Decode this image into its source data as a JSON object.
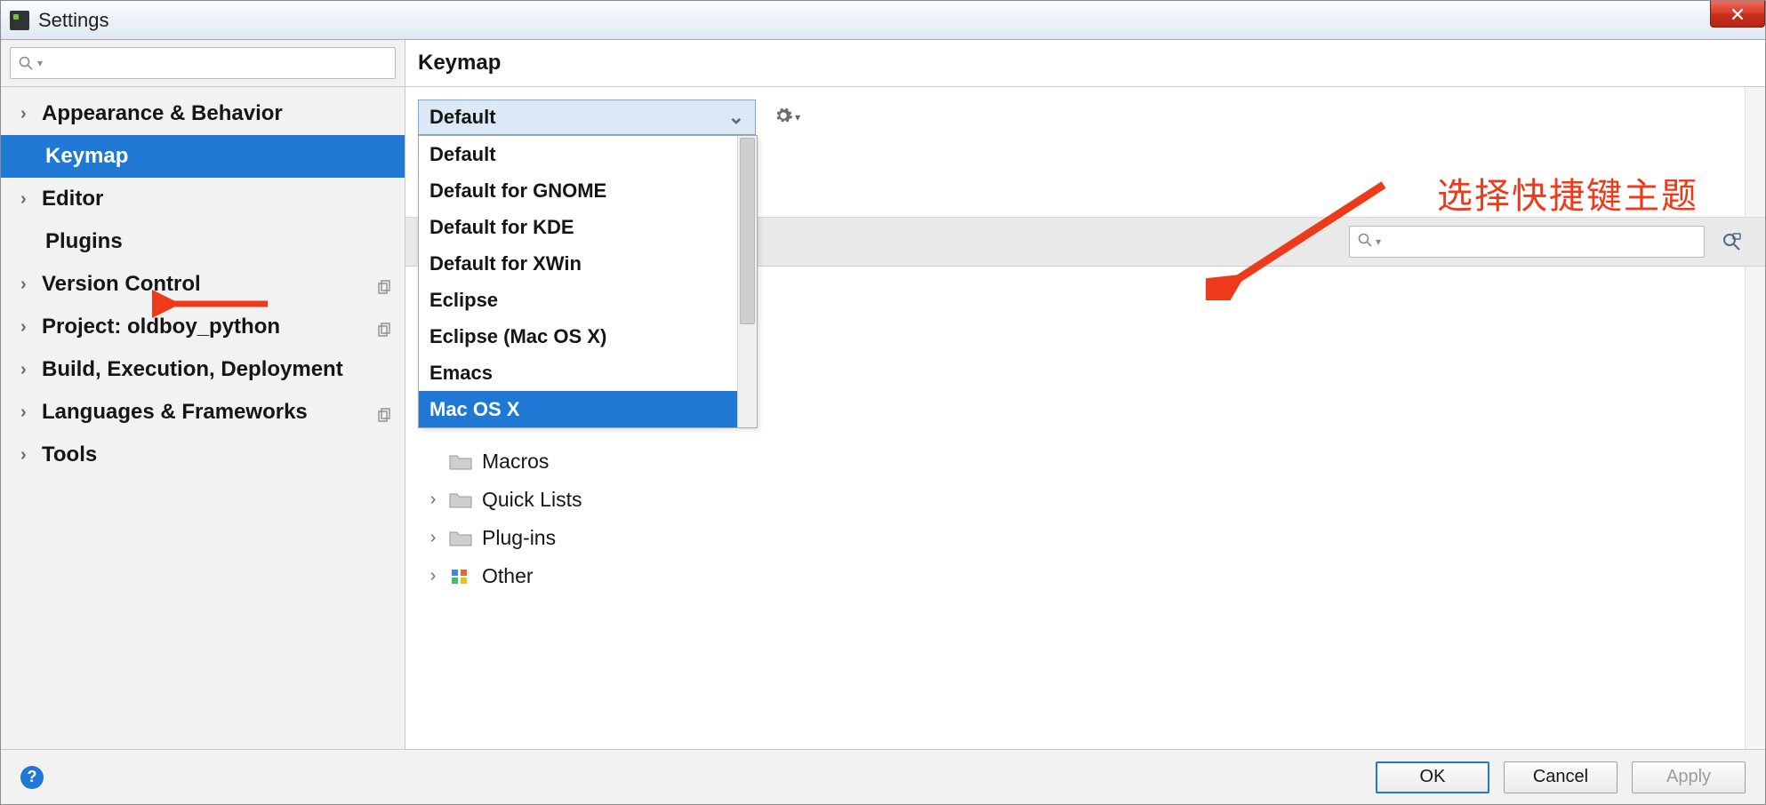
{
  "window": {
    "title": "Settings"
  },
  "sidebar": {
    "search_placeholder": "",
    "items": [
      {
        "label": "Appearance & Behavior",
        "expandable": true
      },
      {
        "label": "Keymap",
        "expandable": false,
        "selected": true,
        "child": true
      },
      {
        "label": "Editor",
        "expandable": true
      },
      {
        "label": "Plugins",
        "expandable": false,
        "child": true
      },
      {
        "label": "Version Control",
        "expandable": true,
        "copy": true
      },
      {
        "label": "Project: oldboy_python",
        "expandable": true,
        "copy": true
      },
      {
        "label": "Build, Execution, Deployment",
        "expandable": true
      },
      {
        "label": "Languages & Frameworks",
        "expandable": true,
        "copy": true
      },
      {
        "label": "Tools",
        "expandable": true
      }
    ]
  },
  "main": {
    "title": "Keymap",
    "select_value": "Default",
    "dropdown": [
      "Default",
      "Default for GNOME",
      "Default for KDE",
      "Default for XWin",
      "Eclipse",
      "Eclipse (Mac OS X)",
      "Emacs",
      "Mac OS X"
    ],
    "dropdown_hover_index": 7,
    "tree_peek": [
      {
        "label": "Macros",
        "expandable": false
      },
      {
        "label": "Quick Lists",
        "expandable": true
      },
      {
        "label": "Plug-ins",
        "expandable": true
      },
      {
        "label": "Other",
        "expandable": true,
        "colorful": true
      }
    ],
    "search_placeholder": ""
  },
  "footer": {
    "ok": "OK",
    "cancel": "Cancel",
    "apply": "Apply"
  },
  "annotation": {
    "text": "选择快捷键主题"
  }
}
